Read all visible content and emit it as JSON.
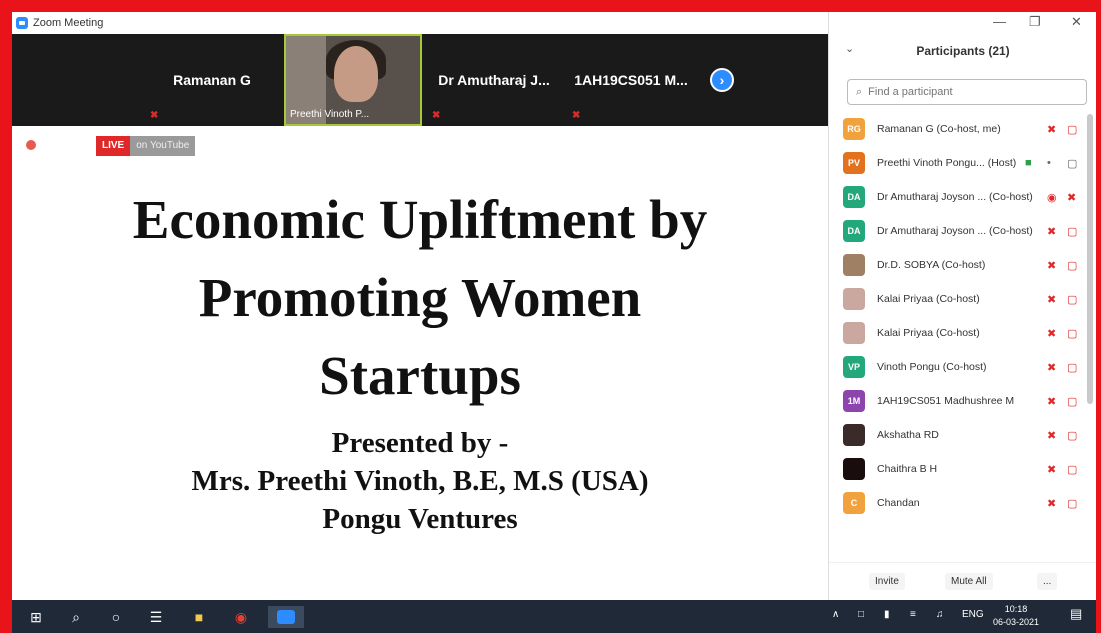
{
  "window": {
    "title": "Zoom Meeting"
  },
  "video_strip": {
    "tiles": [
      {
        "name": "Ramanan G"
      },
      {
        "name": "Preethi Vinoth P..."
      },
      {
        "name": "Dr Amutharaj J..."
      },
      {
        "name": "1AH19CS051  M..."
      }
    ]
  },
  "stream": {
    "live_label": "LIVE",
    "platform_label": "on YouTube"
  },
  "slide": {
    "line1": "Economic Upliftment by",
    "line2": "Promoting Women",
    "line3": "Startups",
    "line4": "Presented by -",
    "line5": "Mrs. Preethi Vinoth, B.E, M.S (USA)",
    "line6": "Pongu Ventures"
  },
  "participants": {
    "header": "Participants (21)",
    "search_placeholder": "Find a participant",
    "list": [
      {
        "initials": "RG",
        "color": "#f2a23c",
        "name": "Ramanan G (Co-host, me)"
      },
      {
        "initials": "PV",
        "color": "#e3721f",
        "name": "Preethi Vinoth Pongu... (Host)"
      },
      {
        "initials": "DA",
        "color": "#23a87b",
        "name": "Dr Amutharaj Joyson ... (Co-host)"
      },
      {
        "initials": "DA",
        "color": "#23a87b",
        "name": "Dr Amutharaj Joyson ... (Co-host)"
      },
      {
        "initials": "",
        "color": "#a08064",
        "name": "Dr.D. SOBYA (Co-host)"
      },
      {
        "initials": "",
        "color": "#caa8a0",
        "name": "Kalai Priyaa (Co-host)"
      },
      {
        "initials": "",
        "color": "#caa8a0",
        "name": "Kalai Priyaa (Co-host)"
      },
      {
        "initials": "VP",
        "color": "#23a87b",
        "name": "Vinoth Pongu (Co-host)"
      },
      {
        "initials": "1M",
        "color": "#8e44ad",
        "name": "1AH19CS051 Madhushree M"
      },
      {
        "initials": "",
        "color": "#3a2a2a",
        "name": "Akshatha RD"
      },
      {
        "initials": "",
        "color": "#1a0d0d",
        "name": "Chaithra B H"
      },
      {
        "initials": "C",
        "color": "#f2a23c",
        "name": "Chandan"
      }
    ],
    "invite_label": "Invite",
    "mute_all_label": "Mute All",
    "more_label": "..."
  },
  "taskbar": {
    "lang": "ENG",
    "time": "10:18",
    "date": "06-03-2021"
  }
}
